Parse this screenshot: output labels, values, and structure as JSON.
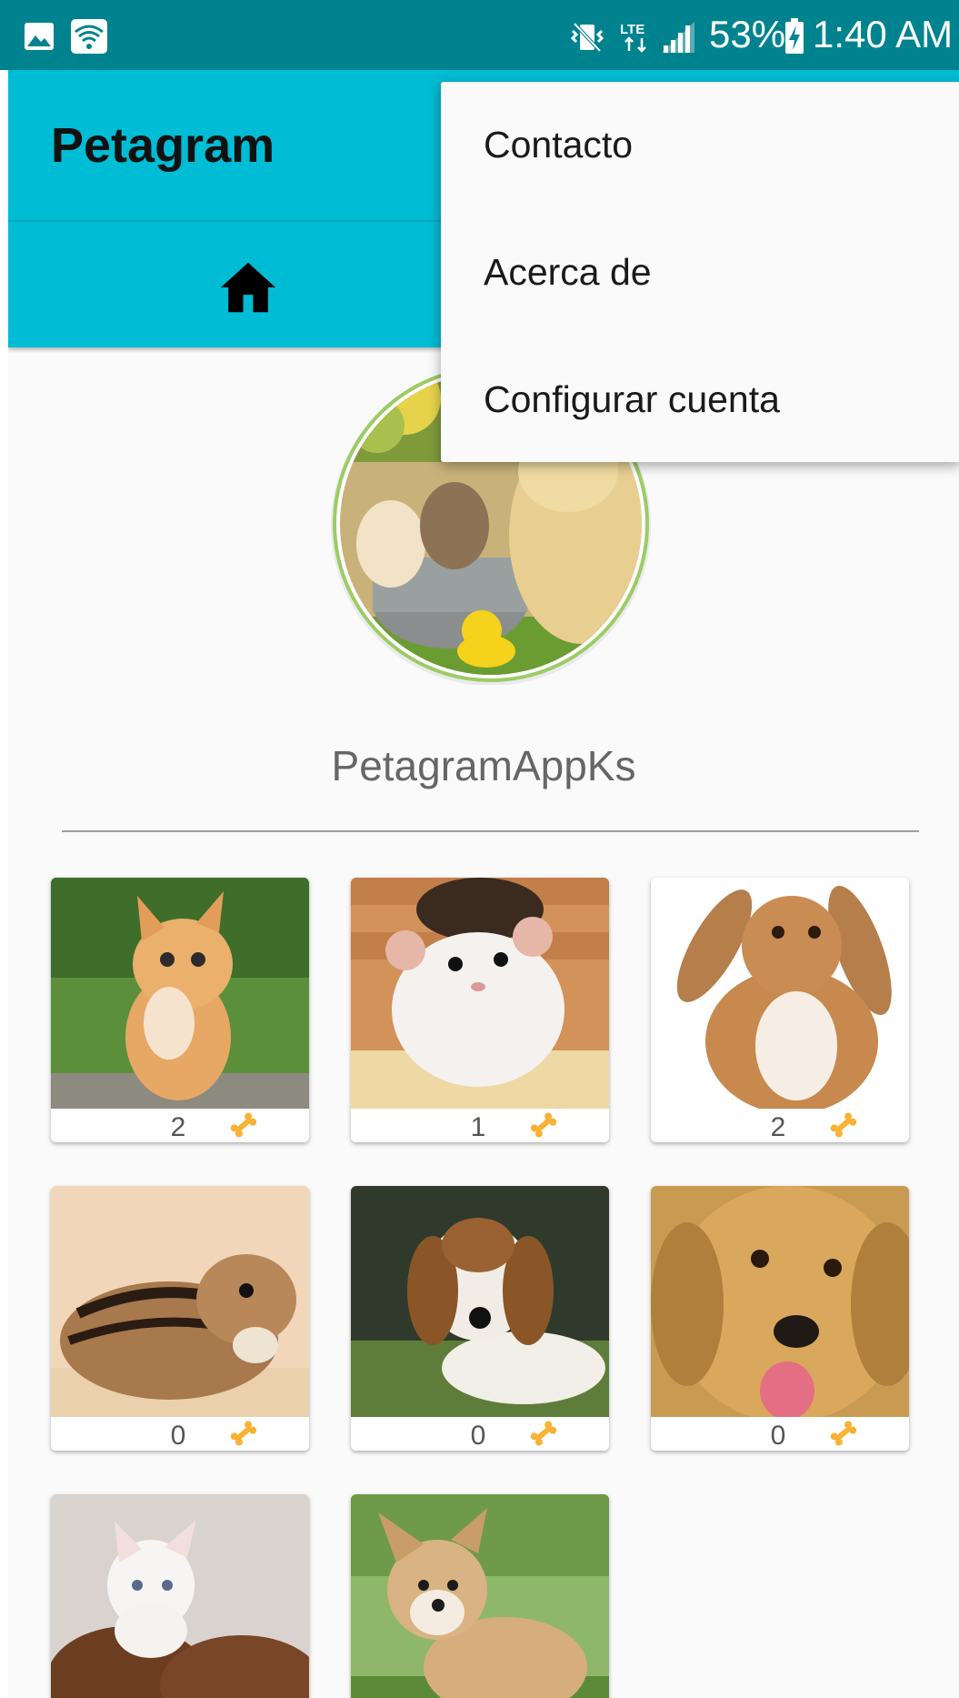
{
  "status_bar": {
    "battery": "53%",
    "time": "1:40 AM",
    "icons": [
      "image-icon",
      "wifi-icon",
      "vibrate-icon",
      "lte-icon",
      "signal-icon",
      "battery-icon"
    ]
  },
  "app_bar": {
    "title": "Petagram"
  },
  "tabs": [
    {
      "icon": "home-icon"
    }
  ],
  "overflow_menu": {
    "items": [
      "Contacto",
      "Acerca de",
      "Configurar cuenta"
    ]
  },
  "profile": {
    "username": "PetagramAppKs",
    "avatar_ring_color": "#8bc34a"
  },
  "colors": {
    "status_bar": "#00838f",
    "primary": "#00bcd4",
    "bone": "#f9b233"
  },
  "pets": [
    {
      "photo": "kitten-orange",
      "likes": "2"
    },
    {
      "photo": "hamster",
      "likes": "1"
    },
    {
      "photo": "rabbit",
      "likes": "2"
    },
    {
      "photo": "chipmunk",
      "likes": "0"
    },
    {
      "photo": "beagle",
      "likes": "0"
    },
    {
      "photo": "golden-puppy",
      "likes": "0"
    },
    {
      "photo": "white-kitten-shoes",
      "likes": ""
    },
    {
      "photo": "corgi-puppy",
      "likes": ""
    }
  ]
}
